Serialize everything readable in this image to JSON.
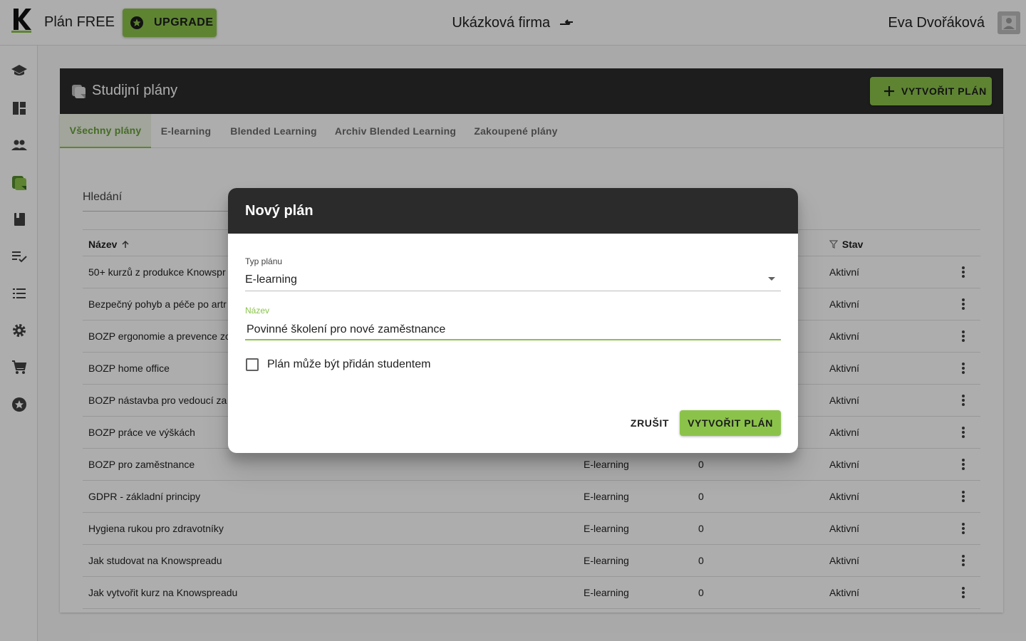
{
  "colors": {
    "accent": "#8bc34a",
    "header_dark": "#2b2b2b"
  },
  "topbar": {
    "plan_label": "Plán FREE",
    "upgrade_label": "UPGRADE",
    "company": "Ukázková firma",
    "user_name": "Eva Dvořáková"
  },
  "sidebar": {
    "items": [
      {
        "icon": "school-icon"
      },
      {
        "icon": "dashboard-icon"
      },
      {
        "icon": "people-icon"
      },
      {
        "icon": "study-plans-icon",
        "active": true
      },
      {
        "icon": "book-icon"
      },
      {
        "icon": "checklist-icon"
      },
      {
        "icon": "list-icon"
      },
      {
        "icon": "settings-icon"
      },
      {
        "icon": "cart-icon"
      },
      {
        "icon": "star-badge-icon"
      }
    ]
  },
  "page": {
    "title": "Studijní plány",
    "create_button": "VYTVOŘIT PLÁN",
    "tabs": [
      {
        "label": "Všechny plány",
        "active": true
      },
      {
        "label": "E-learning"
      },
      {
        "label": "Blended Learning"
      },
      {
        "label": "Archiv Blended Learning"
      },
      {
        "label": "Zakoupené plány"
      }
    ],
    "search_label": "Hledání",
    "columns": {
      "name": "Název",
      "status": "Stav"
    },
    "rows": [
      {
        "name": "50+ kurzů z produkce Knowspr",
        "type": "",
        "count": "",
        "status": "Aktivní"
      },
      {
        "name": "Bezpečný pohyb a péče po artr",
        "type": "",
        "count": "",
        "status": "Aktivní"
      },
      {
        "name": "BOZP ergonomie a prevence zo",
        "type": "",
        "count": "",
        "status": "Aktivní"
      },
      {
        "name": "BOZP home office",
        "type": "",
        "count": "",
        "status": "Aktivní"
      },
      {
        "name": "BOZP nástavba pro vedoucí za",
        "type": "",
        "count": "",
        "status": "Aktivní"
      },
      {
        "name": "BOZP práce ve výškách",
        "type": "",
        "count": "",
        "status": "Aktivní"
      },
      {
        "name": "BOZP pro zaměstnance",
        "type": "E-learning",
        "count": "0",
        "status": "Aktivní"
      },
      {
        "name": "GDPR - základní principy",
        "type": "E-learning",
        "count": "0",
        "status": "Aktivní"
      },
      {
        "name": "Hygiena rukou pro zdravotníky",
        "type": "E-learning",
        "count": "0",
        "status": "Aktivní"
      },
      {
        "name": "Jak studovat na Knowspreadu",
        "type": "E-learning",
        "count": "0",
        "status": "Aktivní"
      },
      {
        "name": "Jak vytvořit kurz na Knowspreadu",
        "type": "E-learning",
        "count": "0",
        "status": "Aktivní"
      }
    ]
  },
  "dialog": {
    "title": "Nový plán",
    "type_label": "Typ plánu",
    "type_value": "E-learning",
    "name_label": "Název",
    "name_value": "Povinné školení pro nové zaměstnance",
    "checkbox_label": "Plán může být přidán studentem",
    "checkbox_checked": false,
    "cancel": "ZRUŠIT",
    "confirm": "VYTVOŘIT PLÁN"
  }
}
